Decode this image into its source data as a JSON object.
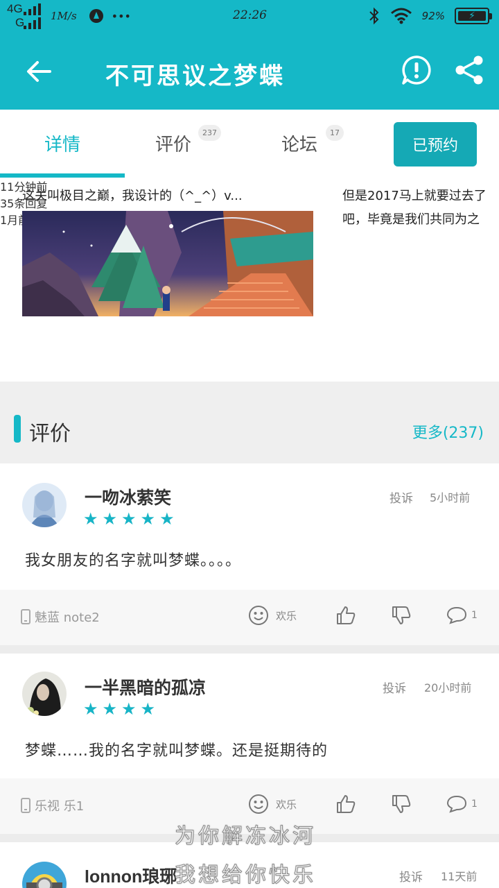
{
  "status_bar": {
    "network_top": "4G",
    "network_bottom": "G",
    "speed": "1M/s",
    "more": "•••",
    "clock": "22:26",
    "battery": "92%"
  },
  "app_bar": {
    "title": "不可思议之梦蝶"
  },
  "tabs": {
    "details": "详情",
    "reviews": "评价",
    "reviews_count": "237",
    "forum": "论坛",
    "forum_count": "17",
    "reserve_label": "已预约"
  },
  "forum_cards": [
    {
      "title": "这关叫极目之巅，我设计的（^_^）v...",
      "time": "11分钟前",
      "replies": "35条回复"
    },
    {
      "title": "但是2017马上就要过去了",
      "title_line2": "吧，毕竟是我们共同为之",
      "time": "1月前"
    }
  ],
  "section": {
    "title": "评价",
    "more": "更多(237)"
  },
  "reviews": [
    {
      "name": "一吻冰萦笑",
      "stars": 5,
      "report": "投诉",
      "time": "5小时前",
      "text": "我女朋友的名字就叫梦蝶。。。。",
      "device": "魅蓝 note2",
      "emoji_label": "欢乐",
      "comments": "1"
    },
    {
      "name": "一半黑暗的孤凉",
      "stars": 4,
      "report": "投诉",
      "time": "20小时前",
      "text": "梦蝶……我的名字就叫梦蝶。还是挺期待的",
      "device": "乐视 乐1",
      "emoji_label": "欢乐",
      "comments": "1"
    },
    {
      "name": "lonnon琅琊",
      "report": "投诉",
      "time": "11天前"
    }
  ],
  "overlay": {
    "line1": "为你解冻冰河",
    "line2": "我想给你快乐"
  },
  "colors": {
    "accent": "#15b8c7",
    "star": "#17b4c6",
    "reserve_button": "#15a9b5"
  }
}
